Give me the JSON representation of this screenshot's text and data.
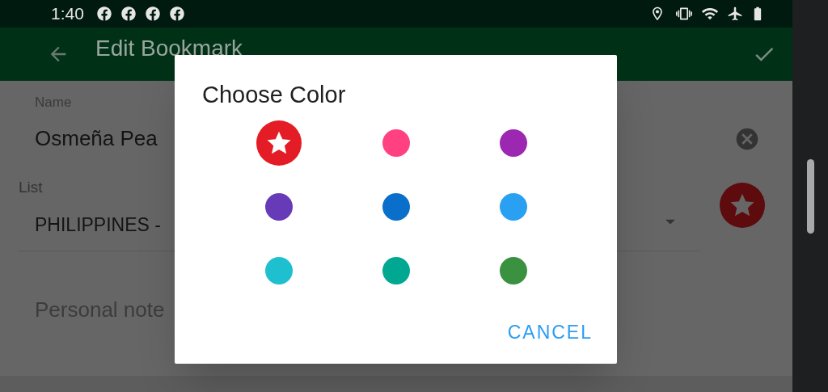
{
  "status_bar": {
    "time": "1:40"
  },
  "app_bar": {
    "title": "Edit Bookmark"
  },
  "form": {
    "name_label": "Name",
    "name_value": "Osmeña Pea",
    "list_label": "List",
    "list_value": "PHILIPPINES -",
    "notes_placeholder": "Personal note"
  },
  "dialog": {
    "title": "Choose Color",
    "colors": [
      {
        "color": "#e31c25",
        "selected": true
      },
      {
        "color": "#ff4081",
        "selected": false
      },
      {
        "color": "#9c27b0",
        "selected": false
      },
      {
        "color": "#673ab7",
        "selected": false
      },
      {
        "color": "#0a6fca",
        "selected": false
      },
      {
        "color": "#2aa0f3",
        "selected": false
      },
      {
        "color": "#1ec0d0",
        "selected": false
      },
      {
        "color": "#00a892",
        "selected": false
      },
      {
        "color": "#3a9140",
        "selected": false
      }
    ],
    "cancel": "CANCEL"
  }
}
